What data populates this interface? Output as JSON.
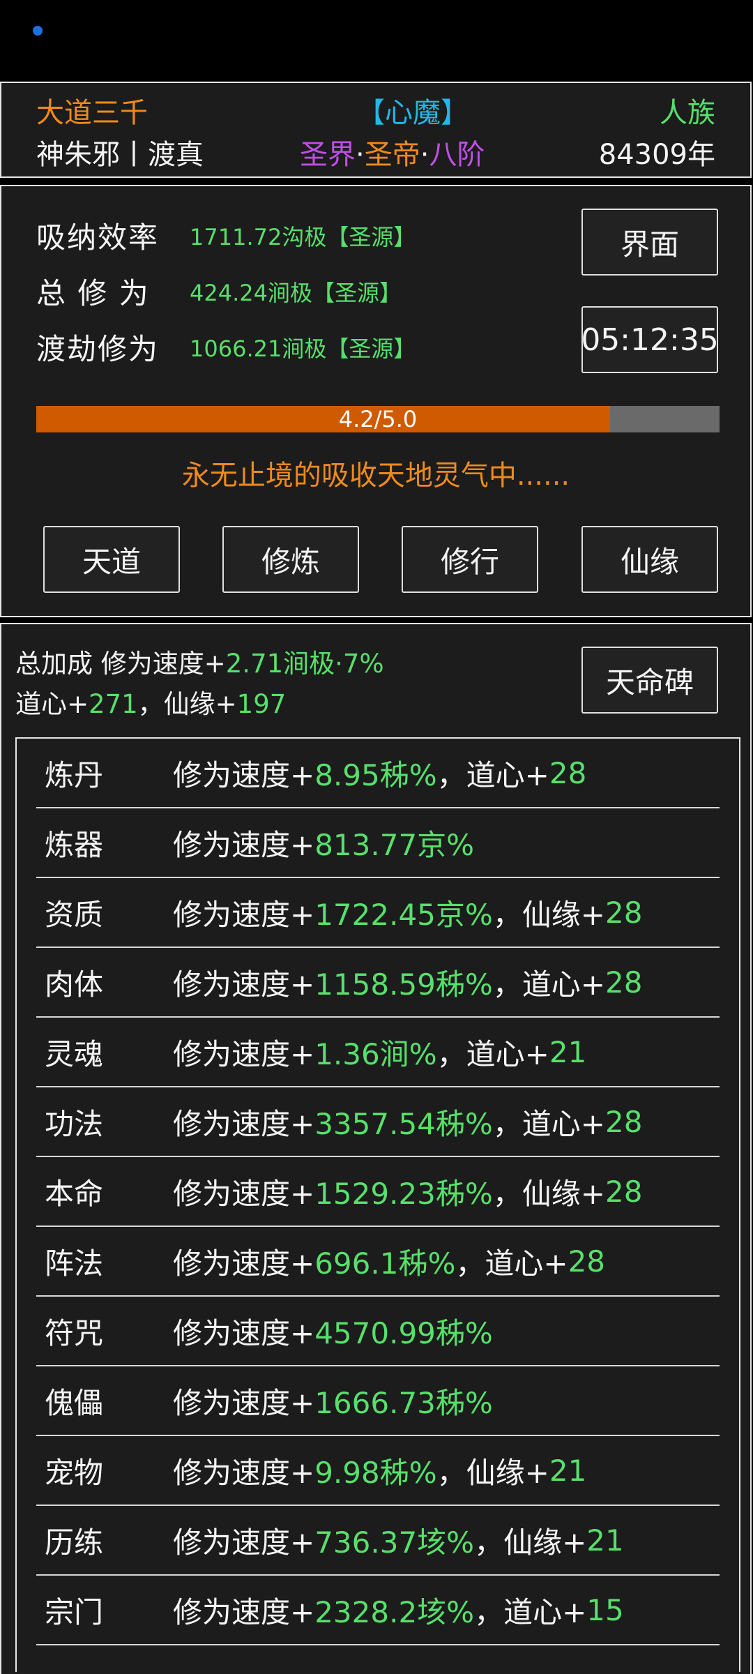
{
  "header": {
    "top_left": "大道三千",
    "top_center": "【心魔】",
    "top_right": "人族",
    "name": "神朱邪丨渡真",
    "realm_a": "圣界",
    "dot1": "·",
    "realm_b": "圣帝",
    "dot2": "·",
    "realm_c": "八阶",
    "years": "84309年"
  },
  "cultivation": {
    "stats": [
      {
        "label": "吸纳效率",
        "value": "1711.72沟极【圣源】"
      },
      {
        "label": "总 修 为",
        "value": "424.24涧极【圣源】"
      },
      {
        "label": "渡劫修为",
        "value": "1066.21涧极【圣源】"
      }
    ],
    "interface_button": "界面",
    "timer": "05:12:35",
    "progress": {
      "label": "4.2/5.0",
      "current": 4.2,
      "max": 5.0
    },
    "status_message": "永无止境的吸收天地灵气中......",
    "nav_buttons": [
      "天道",
      "修炼",
      "修行",
      "仙缘"
    ]
  },
  "bonus": {
    "line1_prefix": "总加成 修为速度+",
    "line1_value": "2.71涧极·7%",
    "line2_a": "道心+",
    "line2_a_value": "271",
    "line2_sep": "，仙缘+",
    "line2_b_value": "197",
    "stele_button": "天命碑",
    "rows": [
      {
        "name": "炼丹",
        "prefix": "修为速度+",
        "value": "8.95秭%",
        "sep": "，道心+",
        "extra": "28"
      },
      {
        "name": "炼器",
        "prefix": "修为速度+",
        "value": "813.77京%",
        "sep": "",
        "extra": ""
      },
      {
        "name": "资质",
        "prefix": "修为速度+",
        "value": "1722.45京%",
        "sep": "，仙缘+",
        "extra": "28"
      },
      {
        "name": "肉体",
        "prefix": "修为速度+",
        "value": "1158.59秭%",
        "sep": "，道心+",
        "extra": "28"
      },
      {
        "name": "灵魂",
        "prefix": "修为速度+",
        "value": "1.36涧%",
        "sep": "，道心+",
        "extra": "21"
      },
      {
        "name": "功法",
        "prefix": "修为速度+",
        "value": "3357.54秭%",
        "sep": "，道心+",
        "extra": "28"
      },
      {
        "name": "本命",
        "prefix": "修为速度+",
        "value": "1529.23秭%",
        "sep": "，仙缘+",
        "extra": "28"
      },
      {
        "name": "阵法",
        "prefix": "修为速度+",
        "value": "696.1秭%",
        "sep": "，道心+",
        "extra": "28"
      },
      {
        "name": "符咒",
        "prefix": "修为速度+",
        "value": "4570.99秭%",
        "sep": "",
        "extra": ""
      },
      {
        "name": "傀儡",
        "prefix": "修为速度+",
        "value": "1666.73秭%",
        "sep": "",
        "extra": ""
      },
      {
        "name": "宠物",
        "prefix": "修为速度+",
        "value": "9.98秭%",
        "sep": "，仙缘+",
        "extra": "21"
      },
      {
        "name": "历练",
        "prefix": "修为速度+",
        "value": "736.37垓%",
        "sep": "，仙缘+",
        "extra": "21"
      },
      {
        "name": "宗门",
        "prefix": "修为速度+",
        "value": "2328.2垓%",
        "sep": "，道心+",
        "extra": "15"
      }
    ]
  }
}
